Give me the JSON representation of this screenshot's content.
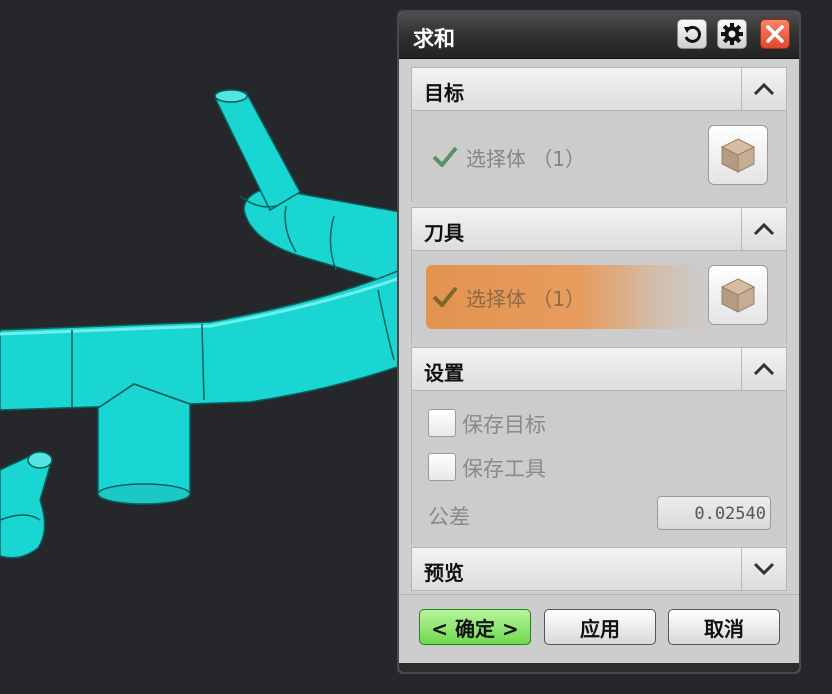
{
  "dialog": {
    "title": "求和",
    "title_buttons": [
      "reset-icon",
      "gear-icon",
      "close-icon"
    ]
  },
  "sections": {
    "target": {
      "label": "目标",
      "expanded": true,
      "select_label": "选择体 （1）",
      "status_icon": "check-icon",
      "select_button_icon": "solid-body-icon"
    },
    "tool": {
      "label": "刀具",
      "expanded": true,
      "select_label": "选择体 （1）",
      "status_icon": "check-icon",
      "select_button_icon": "solid-body-icon",
      "active": true
    },
    "settings": {
      "label": "设置",
      "expanded": true,
      "keep_target_label": "保存目标",
      "keep_target_checked": false,
      "keep_tool_label": "保存工具",
      "keep_tool_checked": false,
      "tolerance_label": "公差",
      "tolerance_value": "0.02540"
    },
    "preview": {
      "label": "预览",
      "expanded": false
    }
  },
  "footer": {
    "ok_label": "< 确定 >",
    "apply_label": "应用",
    "cancel_label": "取消"
  },
  "colors": {
    "model": "#1ad6d2",
    "viewport_bg": "#26272a",
    "active_row": "#e39350",
    "ok_button": "#7ddc5b"
  }
}
